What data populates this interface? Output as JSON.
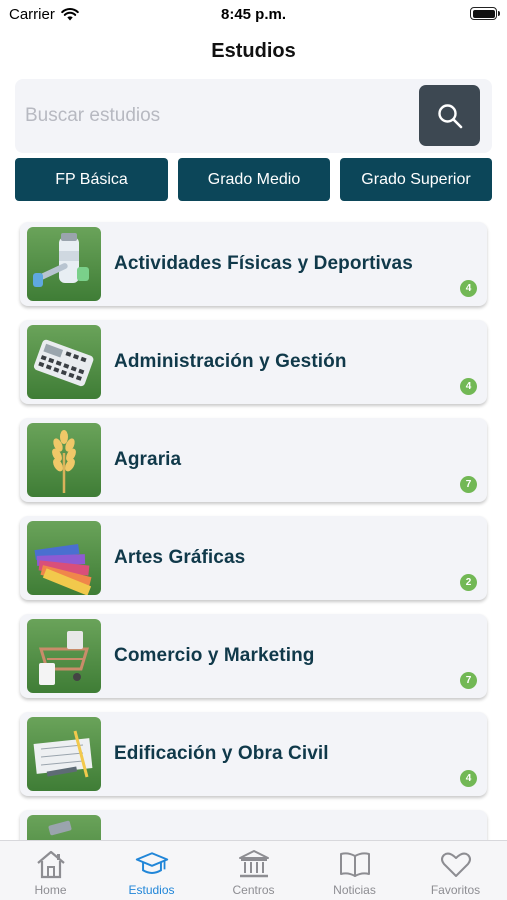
{
  "status_bar": {
    "carrier": "Carrier",
    "time": "8:45 p.m."
  },
  "header": {
    "title": "Estudios"
  },
  "search": {
    "placeholder": "Buscar estudios",
    "value": ""
  },
  "filters": [
    {
      "label": "FP Básica"
    },
    {
      "label": "Grado Medio"
    },
    {
      "label": "Grado Superior"
    }
  ],
  "studies": [
    {
      "name": "Actividades Físicas y Deportivas",
      "count": "4",
      "icon": "sports-bottle-dumbbell-icon"
    },
    {
      "name": "Administración y Gestión",
      "count": "4",
      "icon": "calculator-icon"
    },
    {
      "name": "Agraria",
      "count": "7",
      "icon": "wheat-icon"
    },
    {
      "name": "Artes Gráficas",
      "count": "2",
      "icon": "color-swatches-icon"
    },
    {
      "name": "Comercio y Marketing",
      "count": "7",
      "icon": "shopping-cart-icon"
    },
    {
      "name": "Edificación y Obra Civil",
      "count": "4",
      "icon": "blueprint-tools-icon"
    },
    {
      "name": "",
      "count": "",
      "icon": "electricity-icon"
    }
  ],
  "tab_bar": {
    "tabs": [
      {
        "label": "Home",
        "icon": "home-icon"
      },
      {
        "label": "Estudios",
        "icon": "graduation-cap-icon",
        "active": true
      },
      {
        "label": "Centros",
        "icon": "building-columns-icon"
      },
      {
        "label": "Noticias",
        "icon": "book-open-icon"
      },
      {
        "label": "Favoritos",
        "icon": "heart-icon"
      }
    ]
  },
  "colors": {
    "primary": "#0c4659",
    "search_button": "#3d4852",
    "badge": "#72b855",
    "active_tab": "#2186d8",
    "card_bg": "#f3f4f8"
  }
}
